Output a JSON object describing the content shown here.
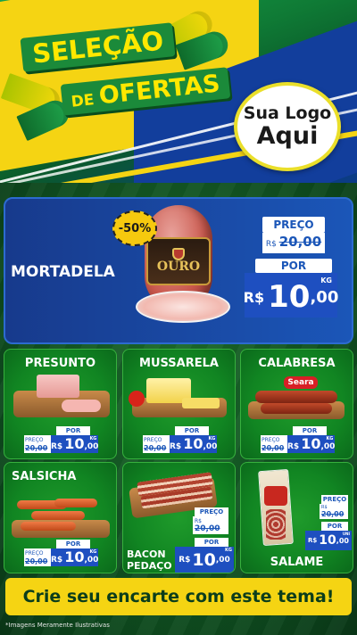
{
  "header": {
    "title_line1": "SELEÇÃO",
    "title_line2_small": "DE",
    "title_line2": "OFERTAS",
    "logo_line1": "Sua Logo",
    "logo_line2": "Aqui"
  },
  "featured": {
    "name": "MORTADELA",
    "discount_badge": "-50%",
    "brand": "OURO",
    "price_label": "PREÇO",
    "old_currency": "R$",
    "old_price": "20,00",
    "new_label": "POR",
    "currency": "R$",
    "price_int": "10",
    "price_dec": ",00",
    "unit": "KG"
  },
  "products": [
    {
      "name": "PRESUNTO",
      "price_label": "PREÇO",
      "old_currency": "R$",
      "old_price": "20,00",
      "new_label": "POR",
      "currency": "R$",
      "price_int": "10",
      "price_dec": ",00",
      "unit": "KG"
    },
    {
      "name": "MUSSARELA",
      "price_label": "PREÇO",
      "old_currency": "R$",
      "old_price": "20,00",
      "new_label": "POR",
      "currency": "R$",
      "price_int": "10",
      "price_dec": ",00",
      "unit": "KG"
    },
    {
      "name": "CALABRESA",
      "brand": "Seara",
      "price_label": "PREÇO",
      "old_currency": "R$",
      "old_price": "20,00",
      "new_label": "POR",
      "currency": "R$",
      "price_int": "10",
      "price_dec": ",00",
      "unit": "KG"
    },
    {
      "name": "SALSICHA",
      "price_label": "PREÇO",
      "old_currency": "R$",
      "old_price": "20,00",
      "new_label": "POR",
      "currency": "R$",
      "price_int": "10",
      "price_dec": ",00",
      "unit": "KG"
    },
    {
      "name_line1": "BACON",
      "name_line2": "PEDAÇO",
      "price_label": "PREÇO",
      "old_currency": "R$",
      "old_price": "20,00",
      "new_label": "POR",
      "currency": "R$",
      "price_int": "10",
      "price_dec": ",00",
      "unit": "KG"
    },
    {
      "name": "SALAME",
      "price_label": "PREÇO",
      "old_currency": "R$",
      "old_price": "20,00",
      "new_label": "POR",
      "currency": "R$",
      "price_int": "10",
      "price_dec": ",00",
      "unit": "UNI"
    }
  ],
  "footer": {
    "banner": "Crie seu encarte com este tema!",
    "disclaimer": "*Imagens Meramente Ilustrativas"
  },
  "colors": {
    "yellow": "#f5d413",
    "green": "#118522",
    "blue": "#1e4fc0",
    "dark_green": "#0b3d1b"
  }
}
